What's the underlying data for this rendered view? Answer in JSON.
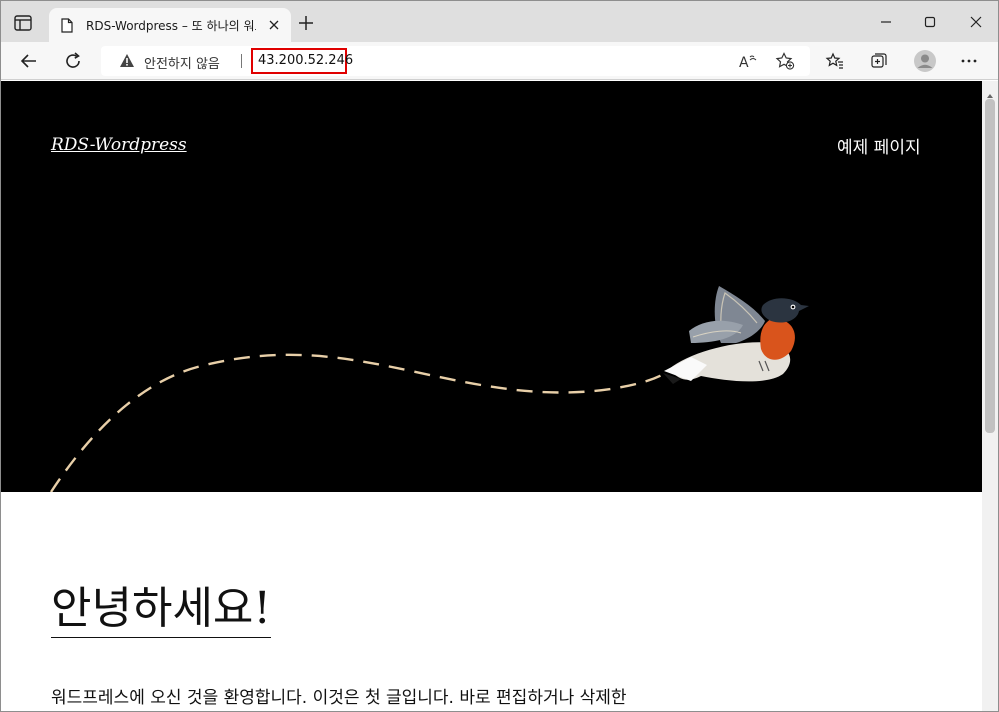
{
  "browser": {
    "tab": {
      "title": "RDS-Wordpress – 또 하나의 워드프레스 사이트"
    },
    "address_bar": {
      "security_label": "안전하지 않음",
      "url": "43.200.52.246"
    }
  },
  "page": {
    "site_title": "RDS-Wordpress",
    "nav": {
      "example_page": "예제 페이지"
    },
    "post": {
      "title": "안녕하세요!",
      "body": "워드프레스에 오신 것을 환영합니다. 이것은 첫 글입니다. 바로 편집하거나 삭제한"
    }
  },
  "colors": {
    "hero_background": "#000000",
    "url_highlight": "#e00000",
    "trail": "#e8cfa8"
  }
}
